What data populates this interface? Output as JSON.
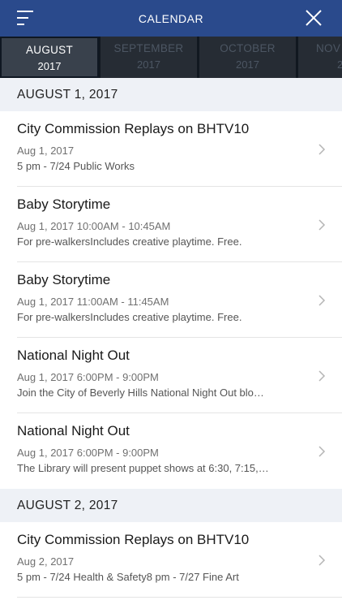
{
  "header": {
    "title": "CALENDAR",
    "menu_icon": "menu-icon",
    "close_icon": "close-icon",
    "bar_color": "#2a4a8c"
  },
  "months": [
    {
      "month": "AUGUST",
      "year": "2017",
      "active": true
    },
    {
      "month": "SEPTEMBER",
      "year": "2017",
      "active": false
    },
    {
      "month": "OCTOBER",
      "year": "2017",
      "active": false
    },
    {
      "month": "NOV",
      "year": "20",
      "active": false
    }
  ],
  "groups": [
    {
      "date": "AUGUST 1, 2017",
      "events": [
        {
          "title": "City Commission Replays on BHTV10",
          "date": "Aug 1, 2017",
          "desc": "5 pm - 7/24 Public Works"
        },
        {
          "title": "Baby Storytime",
          "date": "Aug 1, 2017 10:00AM - 10:45AM",
          "desc": "For pre-walkersIncludes creative playtime. Free."
        },
        {
          "title": "Baby Storytime",
          "date": "Aug 1, 2017 11:00AM - 11:45AM",
          "desc": "For pre-walkersIncludes creative playtime. Free."
        },
        {
          "title": "National Night Out",
          "date": "Aug 1, 2017 6:00PM - 9:00PM",
          "desc": "Join the City of Beverly Hills National Night Out blo…"
        },
        {
          "title": "National Night Out",
          "date": "Aug 1, 2017 6:00PM - 9:00PM",
          "desc": "The Library will present puppet shows at 6:30, 7:15,…"
        }
      ]
    },
    {
      "date": "AUGUST 2, 2017",
      "events": [
        {
          "title": "City Commission Replays on BHTV10",
          "date": "Aug 2, 2017",
          "desc": "5 pm - 7/24 Health & Safety8 pm - 7/27 Fine Art"
        }
      ]
    }
  ]
}
